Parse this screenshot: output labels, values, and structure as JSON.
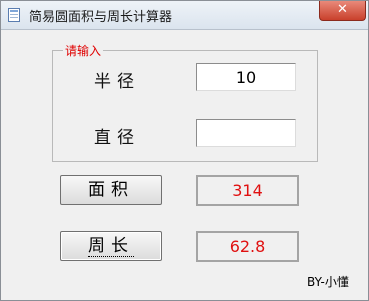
{
  "window": {
    "title": "简易圆面积与周长计算器",
    "close_symbol": "✕"
  },
  "group": {
    "legend": "请输入"
  },
  "inputs": {
    "radius_label": "半径",
    "radius_value": "10",
    "diameter_label": "直径",
    "diameter_value": ""
  },
  "results": {
    "area_button": "面积",
    "area_value": "314",
    "perimeter_button": "周长",
    "perimeter_value": "62.8"
  },
  "footer": {
    "byline": "BY-小懂"
  }
}
